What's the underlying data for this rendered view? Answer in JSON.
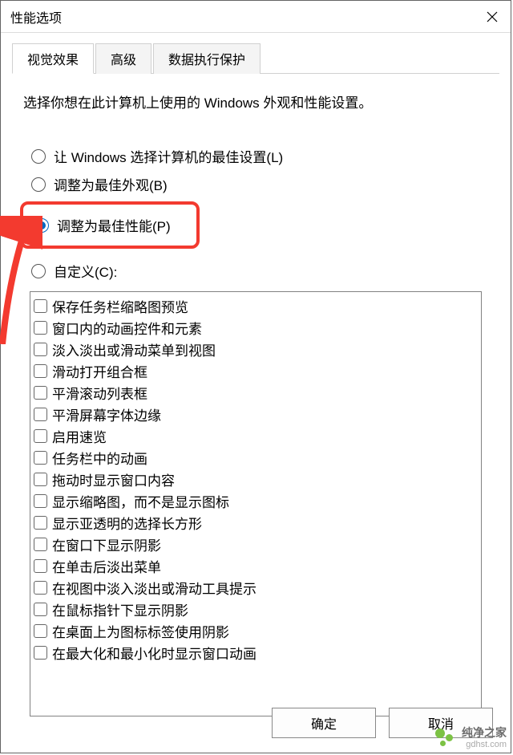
{
  "window": {
    "title": "性能选项"
  },
  "tabs": {
    "items": [
      {
        "label": "视觉效果",
        "active": true
      },
      {
        "label": "高级",
        "active": false
      },
      {
        "label": "数据执行保护",
        "active": false
      }
    ]
  },
  "description": "选择你想在此计算机上使用的 Windows 外观和性能设置。",
  "radios": {
    "let_windows": "让 Windows 选择计算机的最佳设置(L)",
    "best_appearance": "调整为最佳外观(B)",
    "best_performance": "调整为最佳性能(P)",
    "custom": "自定义(C):",
    "selected": "best_performance"
  },
  "checkboxes": [
    "保存任务栏缩略图预览",
    "窗口内的动画控件和元素",
    "淡入淡出或滑动菜单到视图",
    "滑动打开组合框",
    "平滑滚动列表框",
    "平滑屏幕字体边缘",
    "启用速览",
    "任务栏中的动画",
    "拖动时显示窗口内容",
    "显示缩略图，而不是显示图标",
    "显示亚透明的选择长方形",
    "在窗口下显示阴影",
    "在单击后淡出菜单",
    "在视图中淡入淡出或滑动工具提示",
    "在鼠标指针下显示阴影",
    "在桌面上为图标标签使用阴影",
    "在最大化和最小化时显示窗口动画"
  ],
  "buttons": {
    "ok": "确定",
    "cancel": "取消"
  },
  "watermark": {
    "line1": "纯净之家",
    "line2": "gdhst.com"
  }
}
